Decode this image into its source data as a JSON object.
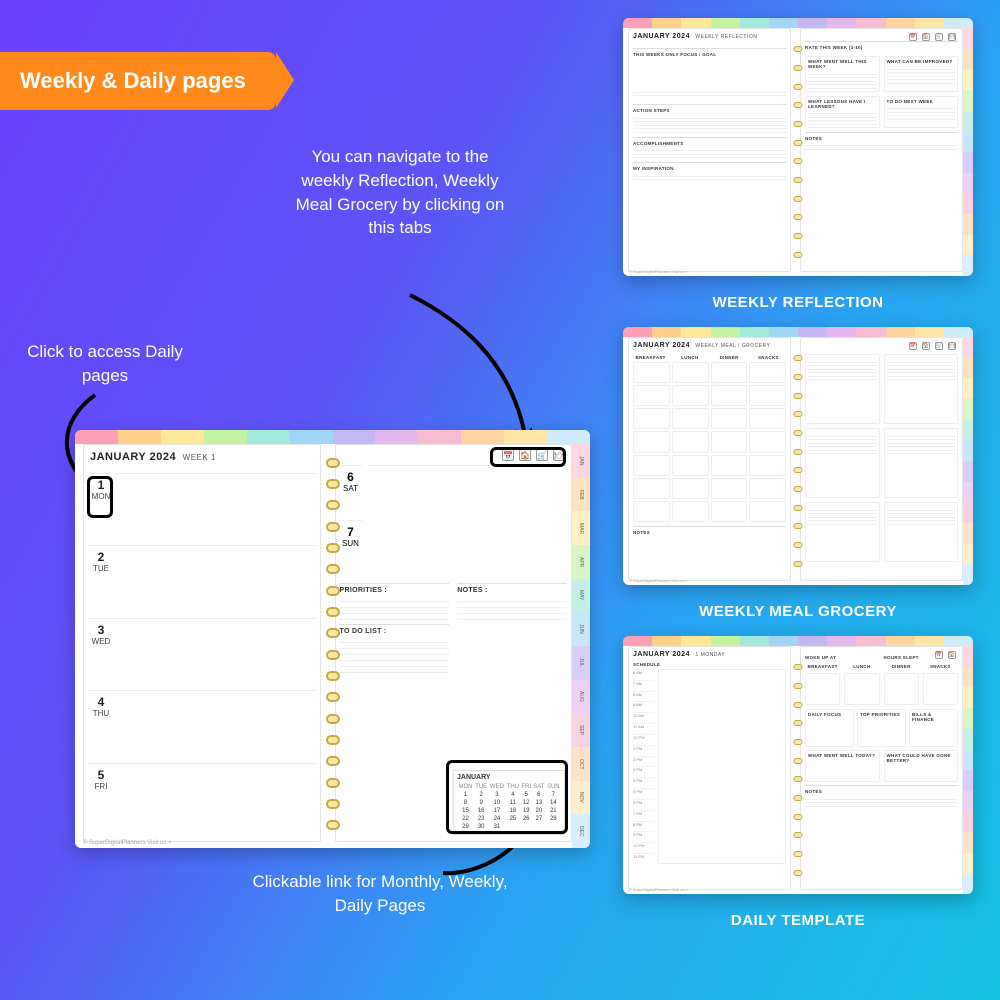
{
  "ribbon": "Weekly & Daily pages",
  "callouts": {
    "tabs": "You can navigate to the weekly Reflection, Weekly Meal Grocery by clicking on this tabs",
    "daily": "Click to access Daily pages",
    "calendar": "Clickable link for Monthly, Weekly, Daily Pages"
  },
  "thumb_labels": {
    "reflection": "WEEKLY REFLECTION",
    "meal": "WEEKLY MEAL GROCERY",
    "daily": "DAILY TEMPLATE"
  },
  "months": [
    "JAN",
    "FEB",
    "MAR",
    "APR",
    "MAY",
    "JUN",
    "JUL",
    "AUG",
    "SEP",
    "OCT",
    "NOV",
    "DEC"
  ],
  "main_planner": {
    "title": "JANUARY 2024",
    "subtitle": "WEEK 1",
    "nav_icons": [
      "📅",
      "🏠",
      "🛒",
      "🍽"
    ],
    "days": [
      {
        "num": "1",
        "dow": "MON"
      },
      {
        "num": "2",
        "dow": "TUE"
      },
      {
        "num": "3",
        "dow": "WED"
      },
      {
        "num": "4",
        "dow": "THU"
      },
      {
        "num": "5",
        "dow": "FRI"
      }
    ],
    "right_days": [
      {
        "num": "6",
        "dow": "SAT"
      },
      {
        "num": "7",
        "dow": "SUN"
      }
    ],
    "sections": {
      "priorities": "PRIORITIES :",
      "notes": "NOTES :",
      "todo": "TO DO LIST :"
    },
    "minical": {
      "title": "JANUARY",
      "dow": [
        "MON",
        "TUE",
        "WED",
        "THU",
        "FRI",
        "SAT",
        "SUN"
      ],
      "rows": [
        [
          "1",
          "2",
          "3",
          "4",
          "5",
          "6",
          "7"
        ],
        [
          "8",
          "9",
          "10",
          "11",
          "12",
          "13",
          "14"
        ],
        [
          "15",
          "16",
          "17",
          "18",
          "19",
          "20",
          "21"
        ],
        [
          "22",
          "23",
          "24",
          "25",
          "26",
          "27",
          "28"
        ],
        [
          "29",
          "30",
          "31",
          "",
          "",
          "",
          ""
        ]
      ]
    },
    "footer": "© SuperDigitalPlanners    Visit us »"
  },
  "reflection": {
    "title": "JANUARY 2024",
    "subtitle": "WEEKLY REFLECTION",
    "left": {
      "focus": "THIS WEEKS ONLY FOCUS / GOAL",
      "actions": "ACTION STEPS",
      "accomp": "ACCOMPLISHMENTS",
      "inspo": "MY INSPIRATION"
    },
    "right": {
      "rate": "RATE THIS WEEK (1-10)",
      "well": "WHAT WENT WELL THIS WEEK?",
      "improve": "WHAT CAN BE IMPROVED?",
      "lessons": "WHAT LESSONS HAVE I LEARNED?",
      "next": "TO DO NEXT WEEK",
      "notes": "NOTES"
    }
  },
  "meal": {
    "title": "JANUARY 2024",
    "subtitle": "WEEKLY MEAL / GROCERY",
    "cols": [
      "BREAKFAST",
      "LUNCH",
      "DINNER",
      "SNACKS"
    ],
    "notes": "NOTES"
  },
  "daily": {
    "title": "JANUARY 2024",
    "subtitle": "1 MONDAY",
    "wake": "WOKE UP AT",
    "sleep": "HOURS SLEPT",
    "schedule": "SCHEDULE",
    "mealcols": [
      "BREAKFAST",
      "LUNCH",
      "DINNER",
      "SNACKS"
    ],
    "sections": [
      "DAILY FOCUS",
      "TOP PRIORITIES",
      "BILLS & FINANCE",
      "WHAT WENT WELL TODAY?",
      "WHAT COULD HAVE GONE BETTER?",
      "NOTES"
    ],
    "hours": [
      "6 AM",
      "7 AM",
      "8 AM",
      "9 AM",
      "10 AM",
      "11 AM",
      "12 PM",
      "1 PM",
      "2 PM",
      "3 PM",
      "4 PM",
      "5 PM",
      "6 PM",
      "7 PM",
      "8 PM",
      "9 PM",
      "10 PM",
      "11 PM"
    ]
  }
}
